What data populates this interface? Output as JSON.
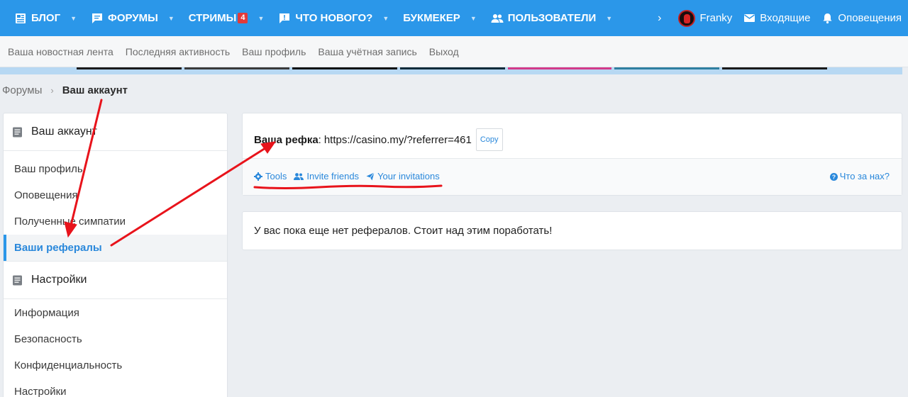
{
  "nav": {
    "items": [
      {
        "label": "БЛОГ",
        "icon": "newspaper-icon",
        "badge": ""
      },
      {
        "label": "ФОРУМЫ",
        "icon": "comment-icon",
        "badge": ""
      },
      {
        "label": "СТРИМЫ",
        "icon": "",
        "badge": "4"
      },
      {
        "label": "ЧТО НОВОГО?",
        "icon": "alert-comment-icon",
        "badge": ""
      },
      {
        "label": "БУКМЕКЕР",
        "icon": "",
        "badge": ""
      },
      {
        "label": "ПОЛЬЗОВАТЕЛИ",
        "icon": "users-icon",
        "badge": ""
      }
    ],
    "user": "Franky",
    "inbox": "Входящие",
    "alerts": "Оповещения",
    "accent": "#2b97e9"
  },
  "subnav": {
    "links": [
      "Ваша новостная лента",
      "Последняя активность",
      "Ваш профиль",
      "Ваша учётная запись",
      "Выход"
    ]
  },
  "breadcrumb": {
    "parent": "Форумы",
    "current": "Ваш аккаунт"
  },
  "sidebar": {
    "section1": {
      "title": "Ваш аккаунт",
      "items": [
        "Ваш профиль",
        "Оповещения",
        "Полученные симпатии",
        "Ваши рефералы"
      ]
    },
    "section2": {
      "title": "Настройки",
      "items": [
        "Информация",
        "Безопасность",
        "Конфиденциальность",
        "Настройки"
      ]
    }
  },
  "referral": {
    "label": "Ваша рефка",
    "colon": ":",
    "url": "https://casino.my/?referrer=461",
    "copy": "Copy",
    "tools": [
      "Tools",
      "Invite friends",
      "Your invitations"
    ],
    "what": "Что за нах?"
  },
  "empty_message": "У вас пока еще нет рефералов. Стоит над этим поработать!",
  "annotation_color": "#e8131b"
}
